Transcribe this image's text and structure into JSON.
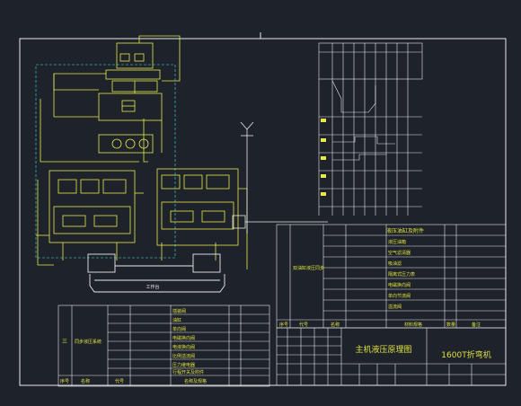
{
  "colors": {
    "background": "#1e232b",
    "frame": "#e8e8e8",
    "circuit": "#e8e84a",
    "dashed": "#40e0e0",
    "table_text": "#e0e040"
  },
  "title_block": {
    "drawing_title": "主机液压原理图",
    "product_name": "1600T折弯机"
  },
  "right_table": {
    "header_left": "液压油缸及附件",
    "rows": [
      "液压油箱",
      "空气滤清器",
      "吸油滤",
      "隔离式压力表",
      "电磁换向阀",
      "单向节流阀",
      "溢流阀",
      "节流阀",
      "压力继电器"
    ],
    "footer": [
      "序号",
      "代号",
      "名称",
      "材料规格",
      "数量",
      "备注"
    ]
  },
  "left_table": {
    "group_label": "同步液压系统",
    "index": "三",
    "rows": [
      "插装阀",
      "油缸",
      "单向阀",
      "电磁换向阀",
      "电液换向阀",
      "比例溢流阀",
      "压力继电器",
      "行程开关及附件"
    ],
    "footer": [
      "序号",
      "名称",
      "代号",
      "名称及规格"
    ]
  },
  "mid_label": "双油缸液压同步",
  "bottom_caption": "工作台"
}
